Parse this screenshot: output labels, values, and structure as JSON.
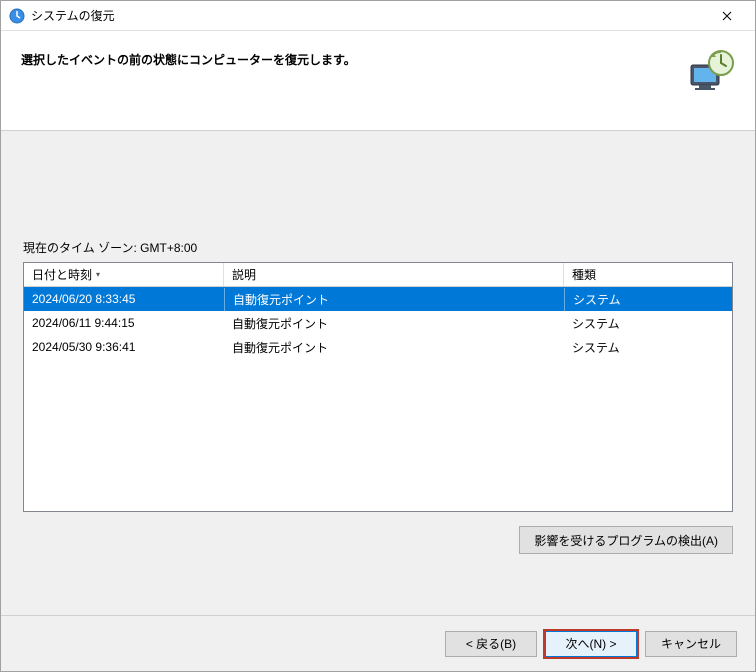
{
  "window": {
    "title": "システムの復元"
  },
  "header": {
    "text": "選択したイベントの前の状態にコンピューターを復元します。"
  },
  "timezone": {
    "label": "現在のタイム ゾーン: GMT+8:00"
  },
  "table": {
    "columns": {
      "date": "日付と時刻",
      "desc": "説明",
      "type": "種類"
    },
    "rows": [
      {
        "date": "2024/06/20 8:33:45",
        "desc": "自動復元ポイント",
        "type": "システム",
        "selected": true
      },
      {
        "date": "2024/06/11 9:44:15",
        "desc": "自動復元ポイント",
        "type": "システム",
        "selected": false
      },
      {
        "date": "2024/05/30 9:36:41",
        "desc": "自動復元ポイント",
        "type": "システム",
        "selected": false
      }
    ]
  },
  "buttons": {
    "scan": "影響を受けるプログラムの検出(A)",
    "back": "< 戻る(B)",
    "next": "次へ(N) >",
    "cancel": "キャンセル"
  }
}
